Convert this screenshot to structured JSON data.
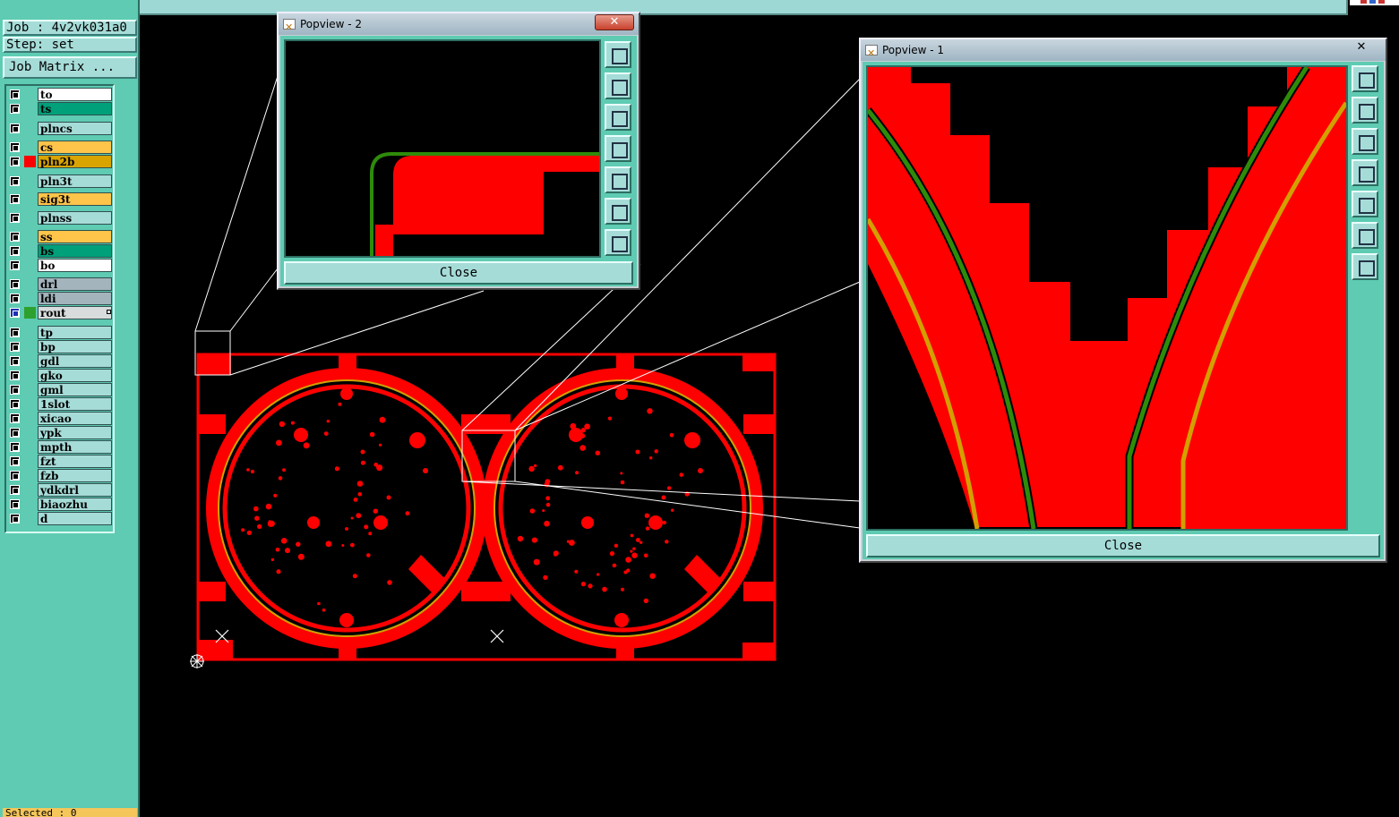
{
  "job": {
    "label": "Job : 4v2vk031a0",
    "step": "Step: set",
    "matrix_button": "Job Matrix ..."
  },
  "layers": [
    {
      "name": "to",
      "color": "#ffffff",
      "swatch": ""
    },
    {
      "name": "ts",
      "color": "#00a07a",
      "swatch": ""
    },
    {
      "name": "plncs",
      "color": "#a6dcd8",
      "swatch": ""
    },
    {
      "name": "cs",
      "color": "#ffc44a",
      "swatch": ""
    },
    {
      "name": "pln2b",
      "color": "#d9a400",
      "swatch": "#ff0000"
    },
    {
      "name": "pln3t",
      "color": "#a6dcd8",
      "swatch": ""
    },
    {
      "name": "sig3t",
      "color": "#ffc44a",
      "swatch": ""
    },
    {
      "name": "plnss",
      "color": "#a6dcd8",
      "swatch": ""
    },
    {
      "name": "ss",
      "color": "#ffc44a",
      "swatch": ""
    },
    {
      "name": "bs",
      "color": "#00a07a",
      "swatch": ""
    },
    {
      "name": "bo",
      "color": "#ffffff",
      "swatch": ""
    },
    {
      "name": "drl",
      "color": "#a3b4bd",
      "swatch": ""
    },
    {
      "name": "ldi",
      "color": "#a3b4bd",
      "swatch": ""
    },
    {
      "name": "rout",
      "color": "#d9dcdc",
      "swatch": "#2ea02e"
    },
    {
      "name": "tp",
      "color": "#a6dcd8",
      "swatch": ""
    },
    {
      "name": "bp",
      "color": "#a6dcd8",
      "swatch": ""
    },
    {
      "name": "gdl",
      "color": "#a6dcd8",
      "swatch": ""
    },
    {
      "name": "gko",
      "color": "#a6dcd8",
      "swatch": ""
    },
    {
      "name": "gml",
      "color": "#a6dcd8",
      "swatch": ""
    },
    {
      "name": "1slot",
      "color": "#a6dcd8",
      "swatch": ""
    },
    {
      "name": "xicao",
      "color": "#a6dcd8",
      "swatch": ""
    },
    {
      "name": "ypk",
      "color": "#a6dcd8",
      "swatch": ""
    },
    {
      "name": "mpth",
      "color": "#a6dcd8",
      "swatch": ""
    },
    {
      "name": "fzt",
      "color": "#a6dcd8",
      "swatch": ""
    },
    {
      "name": "fzb",
      "color": "#a6dcd8",
      "swatch": ""
    },
    {
      "name": "ydkdrl",
      "color": "#a6dcd8",
      "swatch": ""
    },
    {
      "name": "biaozhu",
      "color": "#a6dcd8",
      "swatch": ""
    },
    {
      "name": "d",
      "color": "#a6dcd8",
      "swatch": ""
    }
  ],
  "status": "Selected : 0",
  "popview2": {
    "title": "Popview - 2",
    "close_label": "Close"
  },
  "popview1": {
    "title": "Popview - 1",
    "close_label": "Close"
  },
  "close_glyph": "✕",
  "colors": {
    "copper": "#ff0000",
    "rout": "#2e8b0a",
    "outline": "#d2a000",
    "panel": "#5ecbb2"
  }
}
